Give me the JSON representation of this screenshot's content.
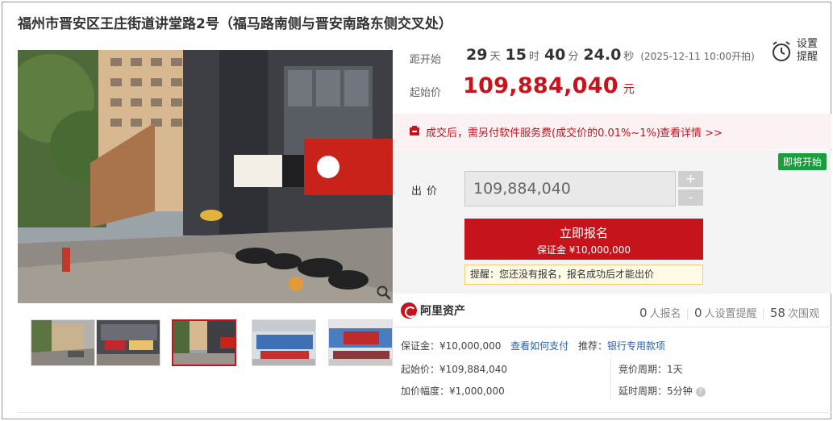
{
  "title": "福州市晋安区王庄街道讲堂路2号（福马路南侧与晋安南路东侧交叉处）",
  "countdown": {
    "label": "距开始",
    "days": "29",
    "days_unit": "天",
    "hours": "15",
    "hours_unit": "时",
    "minutes": "40",
    "minutes_unit": "分",
    "seconds": "24.0",
    "seconds_unit": "秒",
    "start_note": "(2025-12-11 10:00开拍)"
  },
  "start_price": {
    "label": "起始价",
    "value": "109,884,040",
    "unit": "元"
  },
  "remind": {
    "line1": "设置",
    "line2": "提醒"
  },
  "fee_notice": {
    "text": "成交后，需另付软件服务费(成交价的0.01%~1%)",
    "link": "查看详情 >>"
  },
  "status_badge": "即将开始",
  "bid": {
    "label": "出价",
    "value": "109,884,040",
    "plus": "+",
    "minus": "-"
  },
  "signup": {
    "main": "立即报名",
    "deposit": "保证金 ¥10,000,000"
  },
  "notice": "提醒：您还没有报名，报名成功后才能出价",
  "platform": {
    "name": "阿里资产"
  },
  "stats": [
    {
      "count": "0",
      "label": "人报名"
    },
    {
      "count": "0",
      "label": "人设置提醒"
    },
    {
      "count": "58",
      "label": "次围观"
    }
  ],
  "details": {
    "deposit": "保证金：¥10,000,000",
    "how_to_pay": "查看如何支付",
    "recommend_label": "推荐：",
    "recommend_link": "银行专用款项",
    "start_price": "起始价：¥109,884,040",
    "increment": "加价幅度：¥1,000,000",
    "cycle": "竞价周期：1天",
    "delay": "延时周期：5分钟"
  },
  "colors": {
    "accent": "#c7141c",
    "badge": "#1a9d3c",
    "link": "#2462b4"
  }
}
